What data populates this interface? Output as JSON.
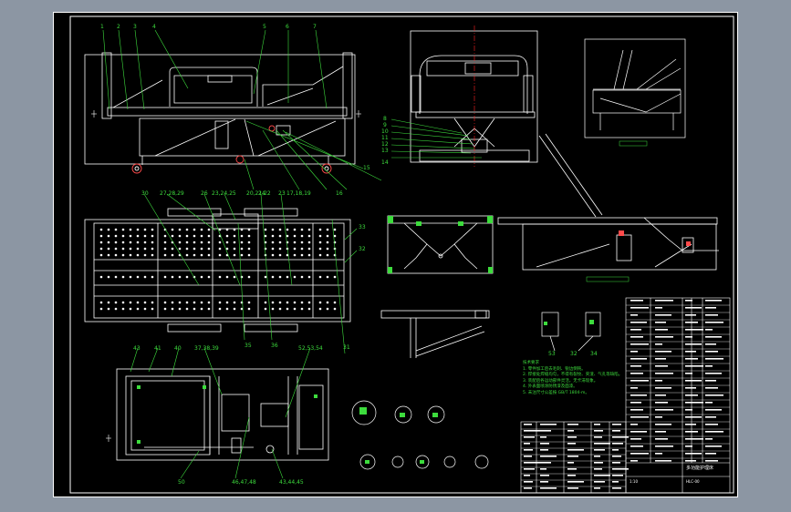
{
  "sheet": {
    "background": "#000000",
    "frame_color": "#ffffff",
    "page_bg": "#8c96a3"
  },
  "colors": {
    "line": "#ffffff",
    "leader": "#3ddc3d",
    "label": "#3ddc3d",
    "accent": "#ff3030",
    "centerline": "#ff2020",
    "hatch": "#ff4a4a"
  },
  "balloons_top": [
    "1",
    "2",
    "3",
    "4",
    "5",
    "6",
    "7"
  ],
  "balloons_front_right": [
    "8",
    "9",
    "10",
    "11",
    "12",
    "13",
    "14"
  ],
  "balloons_front_bottom": [
    "20,21,22",
    "17,18,19",
    "16",
    "15"
  ],
  "balloons_plan_top": [
    "30",
    "27,28,29",
    "26",
    "23,24,25",
    "24",
    "23"
  ],
  "balloons_plan_bottom": [
    "35",
    "36",
    "31"
  ],
  "balloons_plan_side": [
    "33",
    "32"
  ],
  "balloons_frame": [
    "43",
    "41",
    "40",
    "37,38,39",
    "52,53,54",
    "50",
    "46,47,48",
    "43,44,45"
  ],
  "balloons_detail": [
    "53",
    "32",
    "34"
  ],
  "notes_title": "技术要求",
  "notes": [
    "1. 零件加工后去毛刺、锐边倒钝。",
    "2. 焊接处焊缝均匀，不得有裂纹、夹渣、气孔等缺陷。",
    "3. 装配后各运动部件灵活，无卡滞现象。",
    "4. 外表面喷涂防锈漆及面漆。",
    "5. 未注尺寸公差按 GB/T 1804-m。"
  ],
  "title_block": {
    "title": "多功能护理床",
    "drawing_no": "HLC-00",
    "scale": "1:10"
  }
}
